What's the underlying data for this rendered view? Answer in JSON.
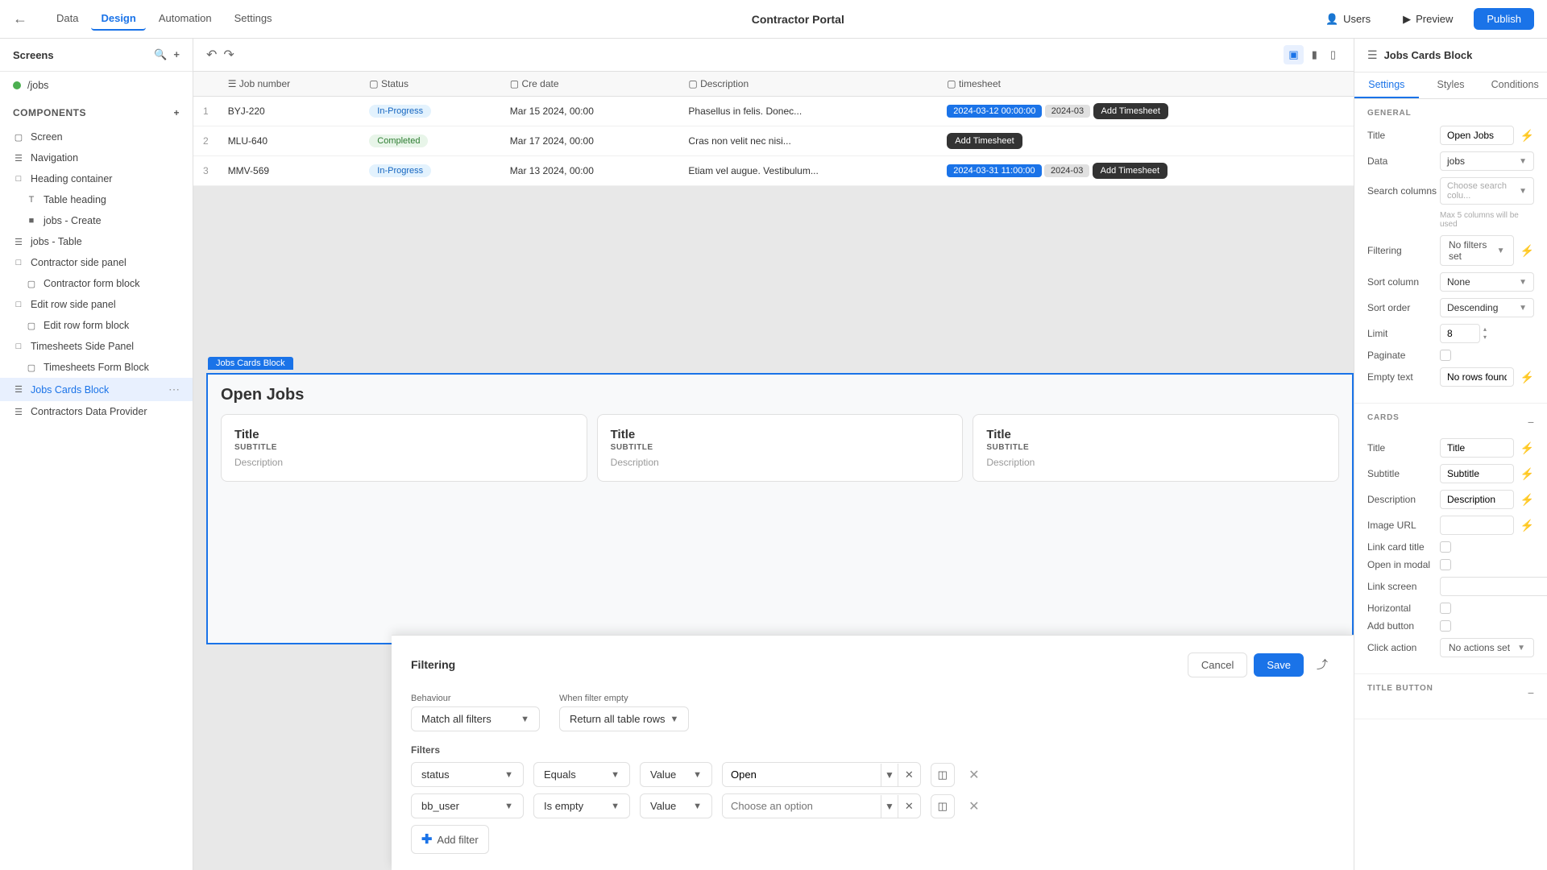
{
  "app": {
    "title": "Contractor Portal",
    "nav_links": [
      "Data",
      "Design",
      "Automation",
      "Settings"
    ],
    "active_nav": "Design",
    "publish_label": "Publish",
    "preview_label": "Preview",
    "users_label": "Users"
  },
  "left_sidebar": {
    "screens_label": "Screens",
    "components_label": "Components",
    "screen_item": "/jobs",
    "items": [
      {
        "label": "Screen",
        "indent": 0
      },
      {
        "label": "Navigation",
        "indent": 0
      },
      {
        "label": "Heading container",
        "indent": 0
      },
      {
        "label": "Table heading",
        "indent": 1
      },
      {
        "label": "jobs - Create",
        "indent": 1
      },
      {
        "label": "jobs - Table",
        "indent": 0
      },
      {
        "label": "Contractor side panel",
        "indent": 0
      },
      {
        "label": "Contractor form block",
        "indent": 1
      },
      {
        "label": "Edit row side panel",
        "indent": 0
      },
      {
        "label": "Edit row form block",
        "indent": 1
      },
      {
        "label": "Timesheets Side Panel",
        "indent": 0
      },
      {
        "label": "Timesheets Form Block",
        "indent": 1
      },
      {
        "label": "Jobs Cards Block",
        "indent": 0,
        "active": true
      },
      {
        "label": "Contractors Data Provider",
        "indent": 0
      }
    ]
  },
  "canvas": {
    "table": {
      "headers": [
        "Job number",
        "Status",
        "Cre date",
        "Description",
        "timesheet"
      ],
      "rows": [
        {
          "num": "1",
          "job": "BYJ-220",
          "status": "In-Progress",
          "status_type": "in-progress",
          "date": "Mar 15 2024, 00:00",
          "description": "Phasellus in felis. Donec...",
          "date2": "2024-03-12 00:00:00",
          "date3": "2024-03",
          "action": "Add Timesheet"
        },
        {
          "num": "2",
          "job": "MLU-640",
          "status": "Completed",
          "status_type": "completed",
          "date": "Mar 17 2024, 00:00",
          "description": "Cras non velit nec nisi...",
          "date2": "",
          "date3": "",
          "action": "Add Timesheet"
        },
        {
          "num": "3",
          "job": "MMV-569",
          "status": "In-Progress",
          "status_type": "in-progress",
          "date": "Mar 13 2024, 00:00",
          "description": "Etiam vel augue. Vestibulum...",
          "date2": "2024-03-31 11:00:00",
          "date3": "2024-03",
          "action": "Add Timesheet"
        }
      ]
    },
    "jobs_cards": {
      "block_label": "Jobs Cards Block",
      "title": "Open Jobs",
      "cards": [
        {
          "title": "Title",
          "subtitle": "SUBTITLE",
          "description": "Description"
        },
        {
          "title": "Title",
          "subtitle": "SUBTITLE",
          "description": "Description"
        },
        {
          "title": "Title",
          "subtitle": "SUBTITLE",
          "description": "Description"
        }
      ]
    }
  },
  "filtering": {
    "title": "Filtering",
    "cancel_label": "Cancel",
    "save_label": "Save",
    "behaviour_label": "Behaviour",
    "when_filter_empty_label": "When filter empty",
    "behaviour_value": "Match all filters",
    "when_empty_value": "Return all table rows",
    "filters_label": "Filters",
    "filter1": {
      "field": "status",
      "operator": "Equals",
      "type": "Value",
      "value": "Open"
    },
    "filter2": {
      "field": "bb_user",
      "operator": "Is empty",
      "type": "Value",
      "placeholder": "Choose an option"
    },
    "add_filter_label": "Add filter"
  },
  "right_panel": {
    "title": "Jobs Cards Block",
    "tabs": [
      "Settings",
      "Styles",
      "Conditions"
    ],
    "active_tab": "Settings",
    "general_section": "GENERAL",
    "title_label": "Title",
    "title_value": "Open Jobs",
    "data_label": "Data",
    "data_value": "jobs",
    "search_columns_label": "Search columns",
    "search_columns_placeholder": "Choose search colu...",
    "max_columns_note": "Max 5 columns will be used",
    "filtering_label": "Filtering",
    "filtering_value": "No filters set",
    "sort_column_label": "Sort column",
    "sort_column_value": "None",
    "sort_order_label": "Sort order",
    "sort_order_value": "Descending",
    "limit_label": "Limit",
    "limit_value": "8",
    "paginate_label": "Paginate",
    "empty_text_label": "Empty text",
    "empty_text_value": "No rows found",
    "cards_section": "CARDS",
    "card_title_label": "Title",
    "card_title_value": "Title",
    "subtitle_label": "Subtitle",
    "subtitle_value": "Subtitle",
    "description_label": "Description",
    "description_value": "Description",
    "image_url_label": "Image URL",
    "link_card_title_label": "Link card title",
    "open_in_modal_label": "Open in modal",
    "link_screen_label": "Link screen",
    "horizontal_label": "Horizontal",
    "add_button_label": "Add button",
    "click_action_label": "Click action",
    "click_action_value": "No actions set",
    "title_button_section": "TITLE BUTTON"
  }
}
